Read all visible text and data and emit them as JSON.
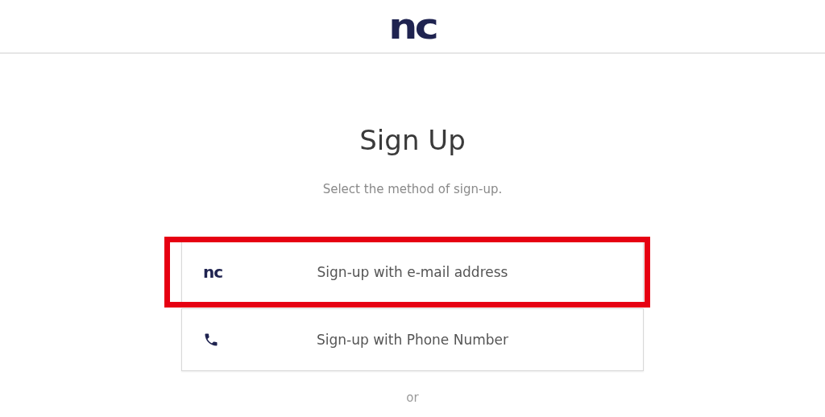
{
  "header": {
    "logo": "nc"
  },
  "title": "Sign Up",
  "subtitle": "Select the method of sign-up.",
  "options": [
    {
      "kind": "brand",
      "logo": "nc",
      "label": "Sign-up with e-mail address",
      "highlighted": true
    },
    {
      "kind": "phone",
      "label": "Sign-up with Phone Number",
      "highlighted": false
    }
  ],
  "divider_text": "or"
}
